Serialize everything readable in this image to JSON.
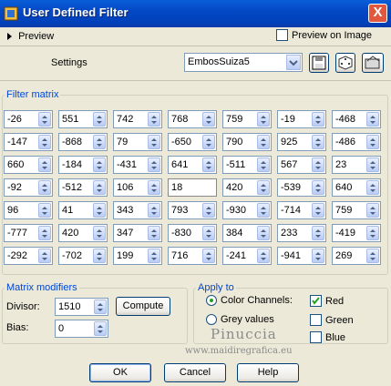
{
  "window": {
    "title": "User Defined Filter",
    "close_glyph": "X"
  },
  "preview": {
    "label": "Preview",
    "preview_on_image": "Preview on Image"
  },
  "settings": {
    "label": "Settings",
    "selected": "EmbosSuiza5"
  },
  "matrix": {
    "label": "Filter matrix",
    "rows": [
      [
        "-26",
        "551",
        "742",
        "768",
        "759",
        "-19",
        "-468"
      ],
      [
        "-147",
        "-868",
        "79",
        "-650",
        "790",
        "925",
        "-486"
      ],
      [
        "660",
        "-184",
        "-431",
        "641",
        "-511",
        "567",
        "23"
      ],
      [
        "-92",
        "-512",
        "106",
        "18",
        "420",
        "-539",
        "640"
      ],
      [
        "96",
        "41",
        "343",
        "793",
        "-930",
        "-714",
        "759"
      ],
      [
        "-777",
        "420",
        "347",
        "-830",
        "384",
        "233",
        "-419"
      ],
      [
        "-292",
        "-702",
        "199",
        "716",
        "-241",
        "-941",
        "269"
      ]
    ]
  },
  "modifiers": {
    "label": "Matrix modifiers",
    "divisor_label": "Divisor:",
    "divisor": "1510",
    "compute": "Compute",
    "bias_label": "Bias:",
    "bias": "0"
  },
  "apply": {
    "label": "Apply to",
    "color_channels": "Color Channels:",
    "grey_values": "Grey values",
    "red": "Red",
    "green": "Green",
    "blue": "Blue"
  },
  "buttons": {
    "ok": "OK",
    "cancel": "Cancel",
    "help": "Help"
  },
  "watermark": {
    "name": "Pinuccia",
    "url": "www.maidiregrafica.eu"
  }
}
